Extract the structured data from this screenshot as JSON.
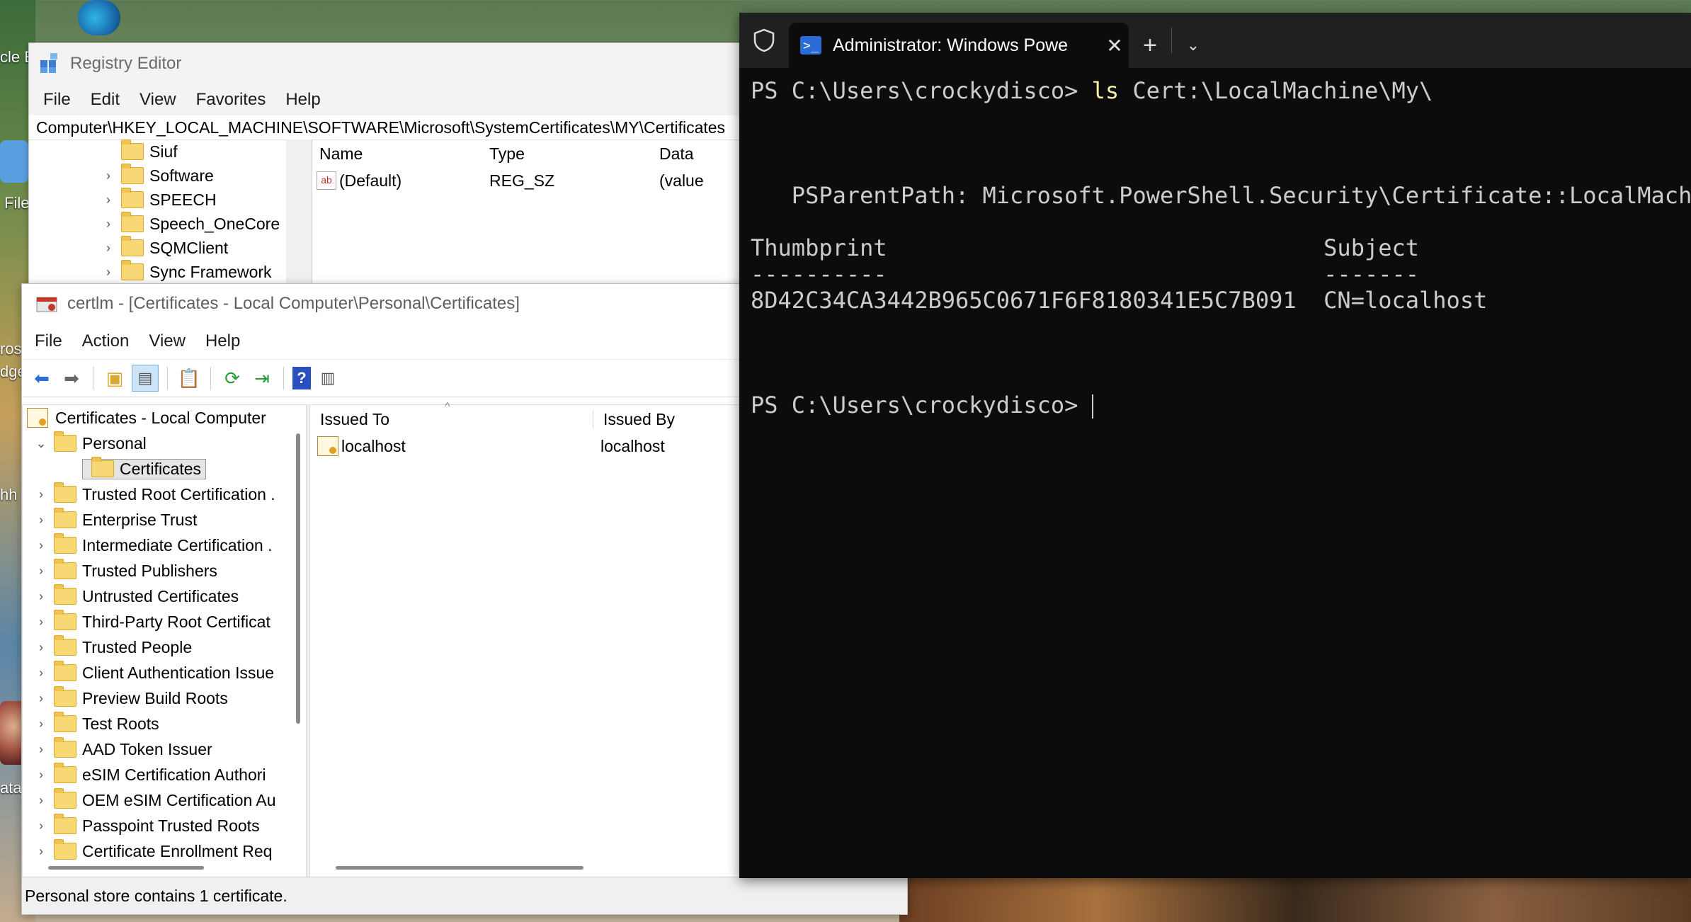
{
  "desktop": {
    "labels": [
      "cle E",
      "File",
      "rosc",
      "dge",
      "hh",
      "ata"
    ]
  },
  "registry_editor": {
    "title": "Registry Editor",
    "menu": [
      "File",
      "Edit",
      "View",
      "Favorites",
      "Help"
    ],
    "address": "Computer\\HKEY_LOCAL_MACHINE\\SOFTWARE\\Microsoft\\SystemCertificates\\MY\\Certificates",
    "tree": [
      {
        "label": "Siuf",
        "expandable": false
      },
      {
        "label": "Software",
        "expandable": true
      },
      {
        "label": "SPEECH",
        "expandable": true
      },
      {
        "label": "Speech_OneCore",
        "expandable": true
      },
      {
        "label": "SQMClient",
        "expandable": true
      },
      {
        "label": "Sync Framework",
        "expandable": true
      }
    ],
    "columns": [
      "Name",
      "Type",
      "Data"
    ],
    "rows": [
      {
        "name": "(Default)",
        "type": "REG_SZ",
        "data": "(value"
      }
    ]
  },
  "certlm": {
    "title": "certlm - [Certificates - Local Computer\\Personal\\Certificates]",
    "menu": [
      "File",
      "Action",
      "View",
      "Help"
    ],
    "tree_root": "Certificates - Local Computer",
    "tree_personal": "Personal",
    "tree_selected": "Certificates",
    "tree_items": [
      "Trusted Root Certification .",
      "Enterprise Trust",
      "Intermediate Certification .",
      "Trusted Publishers",
      "Untrusted Certificates",
      "Third-Party Root Certificat",
      "Trusted People",
      "Client Authentication Issue",
      "Preview Build Roots",
      "Test Roots",
      "AAD Token Issuer",
      "eSIM Certification Authori",
      "OEM eSIM Certification Au",
      "Passpoint Trusted Roots",
      "Certificate Enrollment Req"
    ],
    "columns": [
      "Issued To",
      "Issued By"
    ],
    "rows": [
      {
        "issued_to": "localhost",
        "issued_by": "localhost"
      }
    ],
    "status": "Personal store contains 1 certificate."
  },
  "terminal": {
    "tab_title": "Administrator: Windows Powe",
    "prompt": "PS C:\\Users\\crockydisco>",
    "command_name": "ls",
    "command_args": "Cert:\\LocalMachine\\My\\",
    "psparentpath": "   PSParentPath: Microsoft.PowerShell.Security\\Certificate::LocalMachi",
    "header": "Thumbprint                                Subject",
    "underline": "----------                                -------",
    "result": "8D42C34CA3442B965C0671F6F8180341E5C7B091  CN=localhost",
    "prompt2": "PS C:\\Users\\crockydisco>"
  }
}
